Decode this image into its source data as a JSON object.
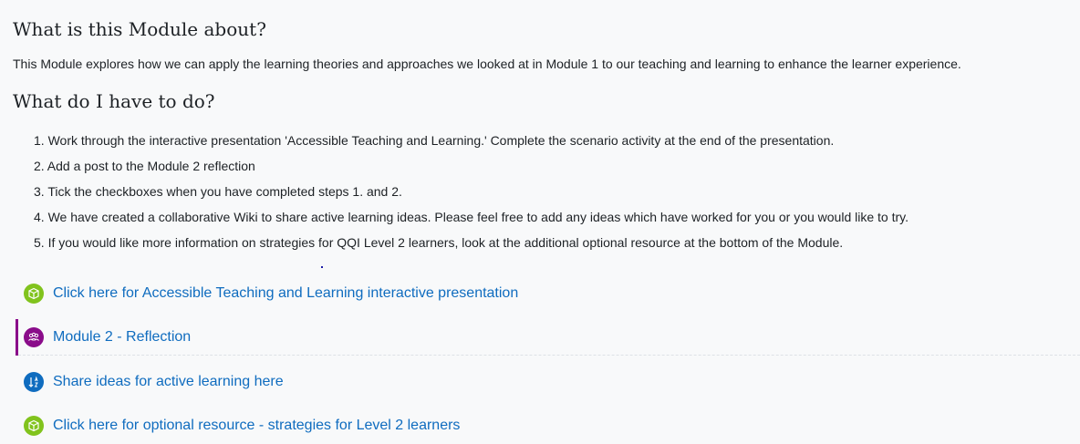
{
  "headings": {
    "about": "What is this Module about?",
    "todo": "What do I have to do?"
  },
  "intro": "This Module explores how we can apply the learning theories and approaches we looked at in Module 1 to our teaching and learning to enhance the learner experience.",
  "steps": [
    "1. Work through the interactive presentation 'Accessible Teaching and Learning.' Complete the scenario activity at the end of the presentation.",
    "2. Add a post to the Module 2 reflection",
    "3. Tick the checkboxes when you have completed steps 1. and 2.",
    "4. We have created a collaborative Wiki to share active learning ideas. Please feel free to add any ideas which have worked for you or you would like to try.",
    "5. If you would like more information on strategies for QQI Level 2 learners, look at the additional optional resource at the bottom of the Module."
  ],
  "activities": [
    {
      "label": "Click here for Accessible Teaching and Learning interactive presentation",
      "icon": "package-icon",
      "color": "#81c31d"
    },
    {
      "label": "Module 2 - Reflection",
      "icon": "forum-icon",
      "color": "#8a0c8a"
    },
    {
      "label": "Share ideas for active learning here",
      "icon": "wiki-icon",
      "color": "#0f6cbf"
    },
    {
      "label": "Click here for optional resource - strategies for Level 2 learners",
      "icon": "package-icon",
      "color": "#81c31d"
    }
  ],
  "colors": {
    "link": "#0f6cbf",
    "highlight_border": "#8a0c8a"
  }
}
